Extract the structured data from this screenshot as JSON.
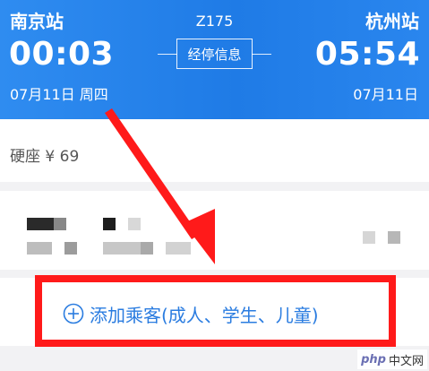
{
  "header": {
    "departure_station": "南京站",
    "arrival_station": "杭州站",
    "train_number": "Z175",
    "departure_time": "00:03",
    "arrival_time": "05:54",
    "departure_date": "07月11日 周四",
    "arrival_date": "07月11日",
    "stops_button_label": "经停信息"
  },
  "seat": {
    "label": "硬座 ¥ 69"
  },
  "add_passenger": {
    "label": "添加乘客(成人、学生、儿童)",
    "icon": "plus-circle-icon"
  },
  "annotation": {
    "highlight_color": "#ff1a1a",
    "arrow_color": "#ff1a1a"
  },
  "watermark": {
    "logo": "php",
    "text": "中文网"
  },
  "colors": {
    "header_blue": "#1f7be6",
    "accent_blue": "#2a7ce0"
  }
}
